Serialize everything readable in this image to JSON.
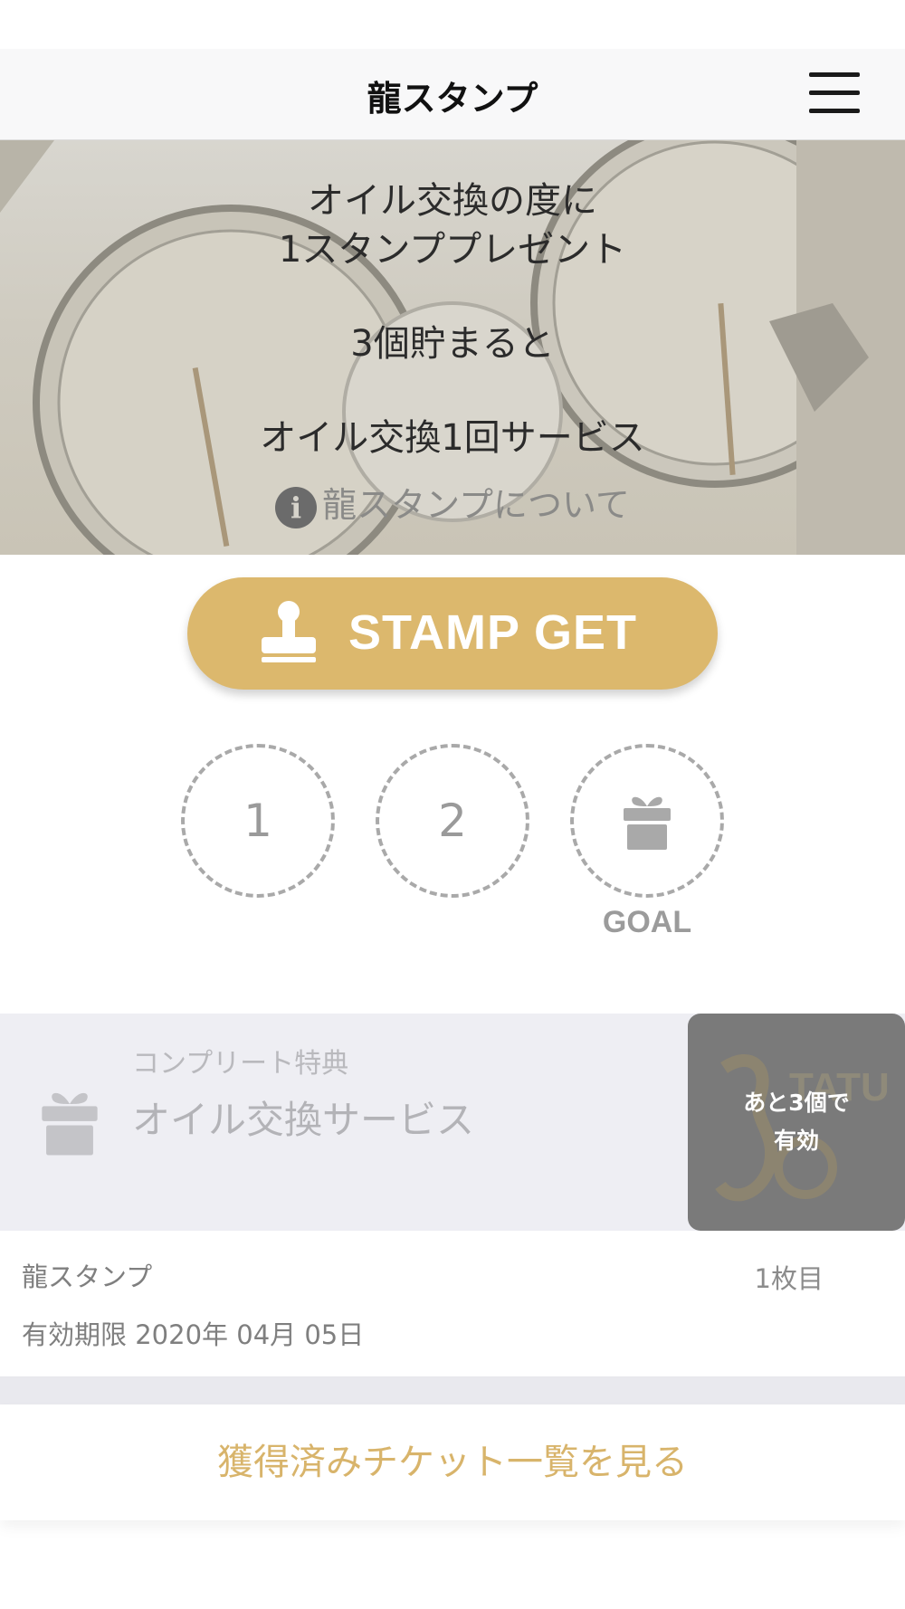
{
  "header": {
    "title": "龍スタンプ",
    "menu_icon": "hamburger-menu-icon"
  },
  "hero": {
    "line1": "オイル交換の度に",
    "line2": "1スタンププレゼント",
    "line3": "3個貯まると",
    "line4": "オイル交換1回サービス",
    "about_icon": "info-icon",
    "about_label": "龍スタンプについて"
  },
  "stamp_button": {
    "label": "STAMP GET",
    "icon": "stamp-icon"
  },
  "stamp_slots": [
    {
      "label": "1"
    },
    {
      "label": "2"
    },
    {
      "label": "",
      "icon": "gift-icon"
    }
  ],
  "goal_label": "GOAL",
  "reward": {
    "small_label": "コンプリート特典",
    "name": "オイル交換サービス",
    "icon": "gift-icon",
    "remaining_line1": "あと3個で",
    "remaining_line2": "有効",
    "watermark_text": "TATU"
  },
  "card": {
    "name": "龍スタンプ",
    "count": "1枚目",
    "expiry": "有効期限 2020年 04月 05日"
  },
  "tickets_link": "獲得済みチケット一覧を見る",
  "colors": {
    "accent": "#dcb86d",
    "link": "#d8b46b",
    "remain_bg": "#7a7a7a"
  }
}
